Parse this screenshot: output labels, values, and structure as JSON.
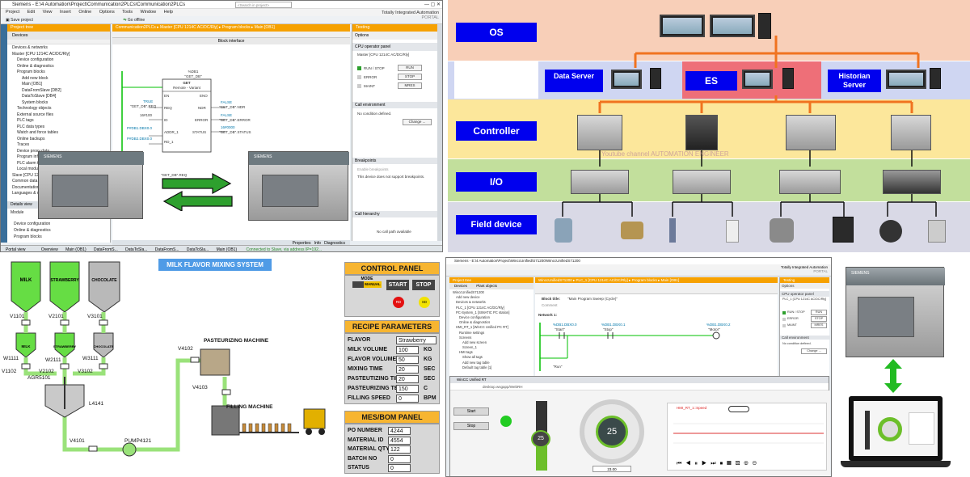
{
  "tia": {
    "title": "Siemens - E:\\4 Automation\\Project\\Communication2PLCs\\Communication2PLCs",
    "menu": [
      "Project",
      "Edit",
      "View",
      "Insert",
      "Online",
      "Options",
      "Tools",
      "Window",
      "Help"
    ],
    "toolbar": {
      "save": "Save project",
      "go_offline": "Go offline",
      "search_placeholder": "<Search in project>"
    },
    "brand": {
      "line1": "Totally Integrated Automation",
      "line2": "PORTAL"
    },
    "project_tree": {
      "header": "Project tree",
      "tab": "Devices",
      "items": [
        "Devices & networks",
        "Master [CPU 1214C AC/DC/Rly]",
        "Device configuration",
        "Online & diagnostics",
        "Program blocks",
        "Add new block",
        "Main [OB1]",
        "DataFromSlave [DB2]",
        "DataToSlave [DB4]",
        "System blocks",
        "Technology objects",
        "External source files",
        "PLC tags",
        "PLC data types",
        "Watch and force tables",
        "Online backups",
        "Traces",
        "Device proxy data",
        "Program info",
        "PLC alarm text lists",
        "Local modules",
        "Slave [CPU 1214C AC/DC/Rly]",
        "Common data",
        "Documentation settings",
        "Languages & resources"
      ]
    },
    "details": {
      "header": "Details view",
      "module": "Module",
      "items": [
        "Device configuration",
        "Online & diagnostics",
        "Program blocks"
      ]
    },
    "breadcrumb": "Communication2PLCs ▸ Master [CPU 1214C AC/DC/Rly] ▸ Program blocks ▸ Main [OB1]",
    "block_interface": "Block interface",
    "get_block": {
      "db": "%DB1",
      "name": "\"GET_DB\"",
      "title": "GET",
      "subtitle": "Remote - Variant",
      "en": "EN",
      "eno": "ENO",
      "req": "REQ",
      "id": "ID",
      "addr": "ADDR_1",
      "rd": "RD_1",
      "ndr": "NDR",
      "error": "ERROR",
      "status": "STATUS",
      "req_val": "TRUE",
      "req_tag": "\"GET_DB\".REQ",
      "id_val": "16#100",
      "addr_val": "P#DB1.DBX0.0",
      "rd_val": "P#DB2.DBX0.0",
      "ndr_val": "FALSE",
      "ndr_tag": "\"GET_DB\".NDR",
      "error_val": "FALSE",
      "error_tag": "\"GET_DB\".ERROR",
      "status_val": "16#0000",
      "status_tag": "\"GET_DB\".STATUS"
    },
    "network2": "Network 2:",
    "net2_tag": "\"GET_DB\".REQ",
    "bottom_tabs": [
      "Properties",
      "Info",
      "Diagnostics"
    ],
    "testing": {
      "header": "Testing",
      "options": "Options",
      "cpu_panel": "CPU operator panel",
      "plc_name": "Master [CPU 1214C AC/DC/Rly]",
      "run_stop": "RUN / STOP",
      "error": "ERROR",
      "maint": "MAINT",
      "run_btn": "RUN",
      "stop_btn": "STOP",
      "mres_btn": "MRES",
      "call_env": "Call environment",
      "no_condition": "No condition defined.",
      "change_btn": "Change ...",
      "breakpoints": "Breakpoints",
      "enable_bp": "Enable breakpoints",
      "bp_note": "This device does not support breakpoints.",
      "call_hier": "Call hierarchy",
      "no_call_path": "No call path available"
    },
    "status_bar": {
      "portal": "Portal view",
      "tabs": [
        "Overview",
        "Main (OB1)",
        "DataFromS...",
        "DataToSla...",
        "DataFromS...",
        "DataToSla...",
        "Main (OB1)"
      ],
      "connected": "Connected to Slave, via address IP=192..."
    }
  },
  "arch": {
    "levels": [
      "OS",
      "Controller",
      "I/O",
      "Field device"
    ],
    "servers": [
      "Data Server",
      "ES",
      "Historian Server"
    ],
    "watermark": "Youtube channel  AUTOMATION ENGINEER",
    "colors": {
      "os_band": "#f8cfb8",
      "server_band": "#cfd6f2",
      "controller_band": "#fce79b",
      "io_band": "#c2df9c",
      "field_band": "#d9d9e6",
      "es_box": "#ee6f78",
      "label_blue": "#0000ee",
      "connector": "#f0731f"
    }
  },
  "scada": {
    "title": "MILK FLAVOR MIXING SYSTEM",
    "tanks": [
      "MILK",
      "STRAWBERRY",
      "CHOCOLATE"
    ],
    "small_tanks": [
      "MILK",
      "STRAWBERRY",
      "CHOCOLATE"
    ],
    "valves": [
      "V1101",
      "V2101",
      "V3101",
      "W1111",
      "W2111",
      "W3111",
      "V1102",
      "V2102",
      "V3102",
      "AGR5101",
      "L4141",
      "V4101",
      "PUMP4121",
      "V4102",
      "V4103"
    ],
    "machines": [
      "PASTEURIZING MACHINE",
      "FILLING MACHINE"
    ],
    "control_panel": {
      "header": "CONTROL PANEL",
      "mode": "MODE",
      "manual": "MANUAL",
      "start": "START",
      "stop": "STOP",
      "rd": "RD",
      "sd": "SD"
    },
    "recipe": {
      "header": "RECIPE PARAMETERS",
      "rows": [
        {
          "label": "FLAVOR",
          "value": "Strawberry",
          "unit": ""
        },
        {
          "label": "MILK VOLUME",
          "value": "100",
          "unit": "KG"
        },
        {
          "label": "FLAVOR VOLUME",
          "value": "50",
          "unit": "KG"
        },
        {
          "label": "MIXING TIME",
          "value": "20",
          "unit": "SEC"
        },
        {
          "label": "PASTEUTIZING TIME",
          "value": "20",
          "unit": "SEC"
        },
        {
          "label": "PASTEURIZING TEMP",
          "value": "150",
          "unit": "C"
        },
        {
          "label": "FILLING SPEED",
          "value": "0",
          "unit": "BPM"
        }
      ]
    },
    "mes": {
      "header": "MES/BOM PANEL",
      "rows": [
        {
          "label": "PO NUMBER",
          "value": "4244"
        },
        {
          "label": "MATERIAL ID",
          "value": "4554"
        },
        {
          "label": "MATERIAL QTY",
          "value": "122"
        },
        {
          "label": "BATCH NO",
          "value": "0"
        },
        {
          "label": "STATUS",
          "value": "0"
        }
      ]
    },
    "colors": {
      "green": "#66dd44",
      "gray_tank": "#b9b9b9",
      "pipe": "#9ae27a",
      "panel_header": "#f7b531",
      "title_bg": "#4f9be6"
    }
  },
  "tia2": {
    "title": "Siemens - E:\\4 Automation\\Project\\WinccUnified\\S71200\\WinccUnifiedS71200",
    "brand": {
      "line1": "Totally Integrated Automation",
      "line2": "PORTAL"
    },
    "tabs": [
      "Devices",
      "Plant objects"
    ],
    "breadcrumb": "WinccUnifiedS71200 ▸ PLC_1 [CPU 1214C AC/DC/Rly] ▸ Program blocks ▸ Main [OB1]",
    "block_title": "Block title:",
    "block_comment": "\"Main Program Sweep (Cycle)\"",
    "comment": "Comment",
    "network": "Network 1:",
    "tree": [
      "WinccUnifiedS71200",
      "Add new device",
      "Devices & networks",
      "PLC_1 [CPU 1214C AC/DC/Rly]",
      "PC-System_1 [SIMATIC PC station]",
      "Device configuration",
      "Online & diagnostics",
      "HMI_RT_1 [WinCC Unified PC RT]",
      "Runtime settings",
      "Screens",
      "Add new screen",
      "Screen_1",
      "HMI tags",
      "Show all tags",
      "Add new tag table",
      "Default tag table [1]"
    ],
    "tags": [
      "\"Start\"",
      "\"Stop\"",
      "\"Motor\"",
      "\"Run\"",
      "%DB1.DBX0.0",
      "%DB1.DBX0.1",
      "%DB1.DBX0.2"
    ],
    "testing": {
      "header": "Testing",
      "options": "Options",
      "cpu_panel": "CPU operator panel",
      "plc_name": "PLC_1 [CPU 1214C AC/DC/Rly]",
      "run_stop": "RUN / STOP",
      "error": "ERROR",
      "maint": "MAINT",
      "run_btn": "RUN",
      "stop_btn": "STOP",
      "mres_btn": "MRES",
      "call_env": "Call environment",
      "no_condition": "No condition defined.",
      "change_btn": "Change ..."
    },
    "browser": {
      "tab": "WinCC Unified RT",
      "url": "desktop.wsgapp/WebRH",
      "start": "Start",
      "stop": "Stop",
      "gauge_value": "25",
      "slider_value": "25",
      "input_value": "23.00",
      "trend_legend": "HMI_RT_1::Speed"
    }
  }
}
